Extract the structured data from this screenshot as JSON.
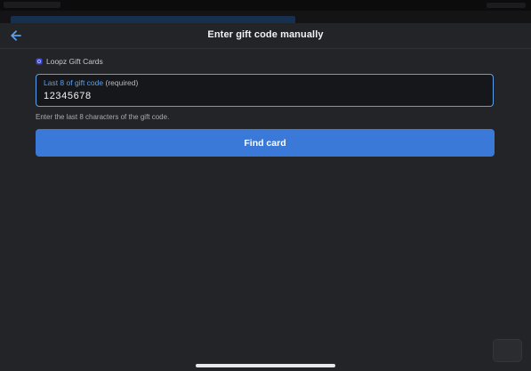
{
  "header": {
    "title": "Enter gift code manually",
    "back_icon": "arrow-left-icon"
  },
  "brand": {
    "name": "Loopz Gift Cards",
    "logo_icon": "loopz-logo-icon"
  },
  "gift_code_field": {
    "label": "Last 8 of gift code",
    "required_label": "(required)",
    "value": "12345678",
    "helper": "Enter the last 8 characters of the gift code."
  },
  "actions": {
    "find_label": "Find card"
  },
  "colors": {
    "accent": "#3a79d8",
    "focus_border": "#5aa0ec",
    "background": "#232427"
  }
}
